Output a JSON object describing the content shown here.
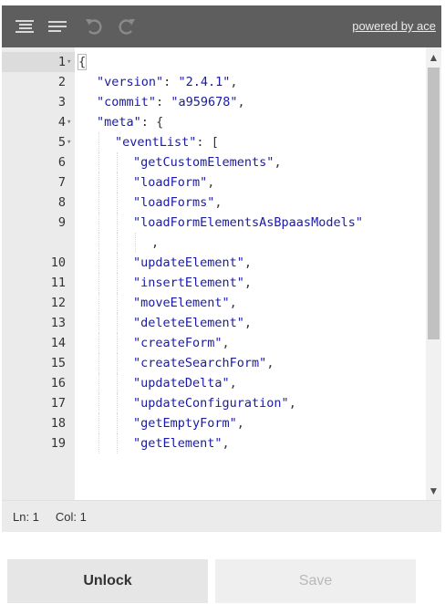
{
  "toolbar": {
    "powered_by": "powered by ace",
    "icons": [
      "format-icon",
      "compact-icon",
      "undo-icon",
      "redo-icon"
    ]
  },
  "editor": {
    "lines": [
      {
        "n": "1",
        "fold": "▾",
        "indent": 0,
        "text": "{"
      },
      {
        "n": "2",
        "fold": "",
        "indent": 1,
        "text": "\"version\": \"2.4.1\","
      },
      {
        "n": "3",
        "fold": "",
        "indent": 1,
        "text": "\"commit\": \"a959678\","
      },
      {
        "n": "4",
        "fold": "▾",
        "indent": 1,
        "text": "\"meta\": {"
      },
      {
        "n": "5",
        "fold": "▾",
        "indent": 2,
        "text": "\"eventList\": ["
      },
      {
        "n": "6",
        "fold": "",
        "indent": 3,
        "text": "\"getCustomElements\","
      },
      {
        "n": "7",
        "fold": "",
        "indent": 3,
        "text": "\"loadForm\","
      },
      {
        "n": "8",
        "fold": "",
        "indent": 3,
        "text": "\"loadForms\","
      },
      {
        "n": "9",
        "fold": "",
        "indent": 3,
        "text": "\"loadFormElementsAsBpaasModels\""
      },
      {
        "n": "",
        "fold": "",
        "indent": 4,
        "text": ","
      },
      {
        "n": "10",
        "fold": "",
        "indent": 3,
        "text": "\"updateElement\","
      },
      {
        "n": "11",
        "fold": "",
        "indent": 3,
        "text": "\"insertElement\","
      },
      {
        "n": "12",
        "fold": "",
        "indent": 3,
        "text": "\"moveElement\","
      },
      {
        "n": "13",
        "fold": "",
        "indent": 3,
        "text": "\"deleteElement\","
      },
      {
        "n": "14",
        "fold": "",
        "indent": 3,
        "text": "\"createForm\","
      },
      {
        "n": "15",
        "fold": "",
        "indent": 3,
        "text": "\"createSearchForm\","
      },
      {
        "n": "16",
        "fold": "",
        "indent": 3,
        "text": "\"updateDelta\","
      },
      {
        "n": "17",
        "fold": "",
        "indent": 3,
        "text": "\"updateConfiguration\","
      },
      {
        "n": "18",
        "fold": "",
        "indent": 3,
        "text": "\"getEmptyForm\","
      },
      {
        "n": "19",
        "fold": "",
        "indent": 3,
        "text": "\"getElement\","
      }
    ]
  },
  "status": {
    "line": "Ln: 1",
    "col": "Col: 1"
  },
  "buttons": {
    "unlock": "Unlock",
    "save": "Save"
  },
  "colors": {
    "toolbar_bg": "#5e5e5e",
    "gutter_bg": "#ebebeb",
    "key_string": "#1a1aa6"
  }
}
